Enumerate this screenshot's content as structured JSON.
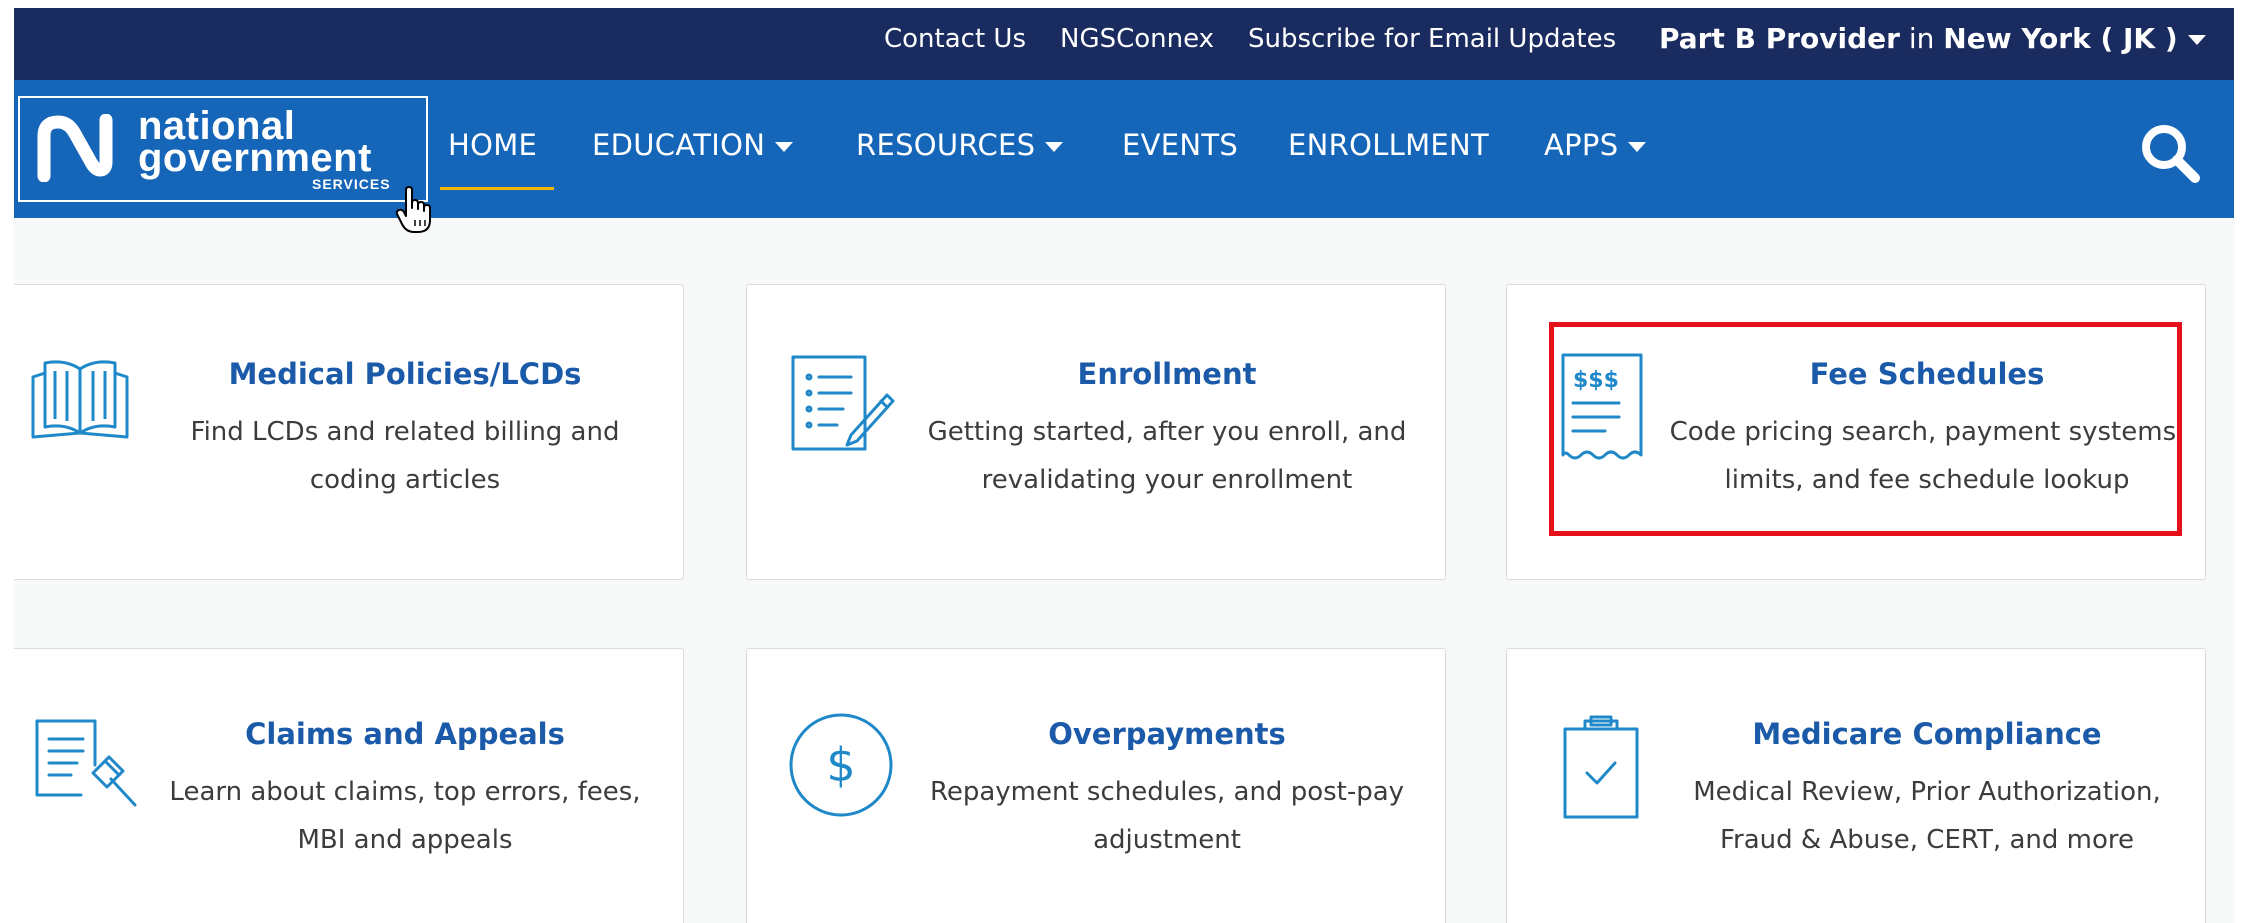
{
  "utility": {
    "contact": "Contact Us",
    "ngsconnex": "NGSConnex",
    "subscribe": "Subscribe for Email Updates",
    "region_bold1": "Part B Provider",
    "region_in": " in ",
    "region_bold2": "New York ( JK )"
  },
  "logo": {
    "line1": "national",
    "line2": "government",
    "line3": "SERVICES"
  },
  "nav": {
    "home": "HOME",
    "education": "EDUCATION",
    "resources": "RESOURCES",
    "events": "EVENTS",
    "enrollment": "ENROLLMENT",
    "apps": "APPS"
  },
  "cards": [
    {
      "title": "Medical Policies/LCDs",
      "line1": "Find LCDs and related billing and",
      "line2": "coding articles"
    },
    {
      "title": "Enrollment",
      "line1": "Getting started, after you enroll, and",
      "line2": "revalidating your enrollment"
    },
    {
      "title": "Fee Schedules",
      "line1": "Code pricing search, payment systems,",
      "line2": "limits, and fee schedule lookup",
      "icon_text": "$$$"
    },
    {
      "title": "Claims and Appeals",
      "line1": "Learn about claims, top errors, fees,",
      "line2": "MBI and appeals"
    },
    {
      "title": "Overpayments",
      "line1": "Repayment schedules, and post-pay",
      "line2": "adjustment",
      "icon_text": "$"
    },
    {
      "title": "Medicare Compliance",
      "line1": "Medical Review, Prior Authorization,",
      "line2": "Fraud & Abuse, CERT, and more"
    }
  ],
  "colors": {
    "utility_bar": "#1a2b5f",
    "nav_bar": "#1565b8",
    "card_title": "#1b5aa8",
    "icon_blue": "#1e88c8",
    "highlight_red": "#e4111b",
    "nav_underline": "#f2b600"
  }
}
